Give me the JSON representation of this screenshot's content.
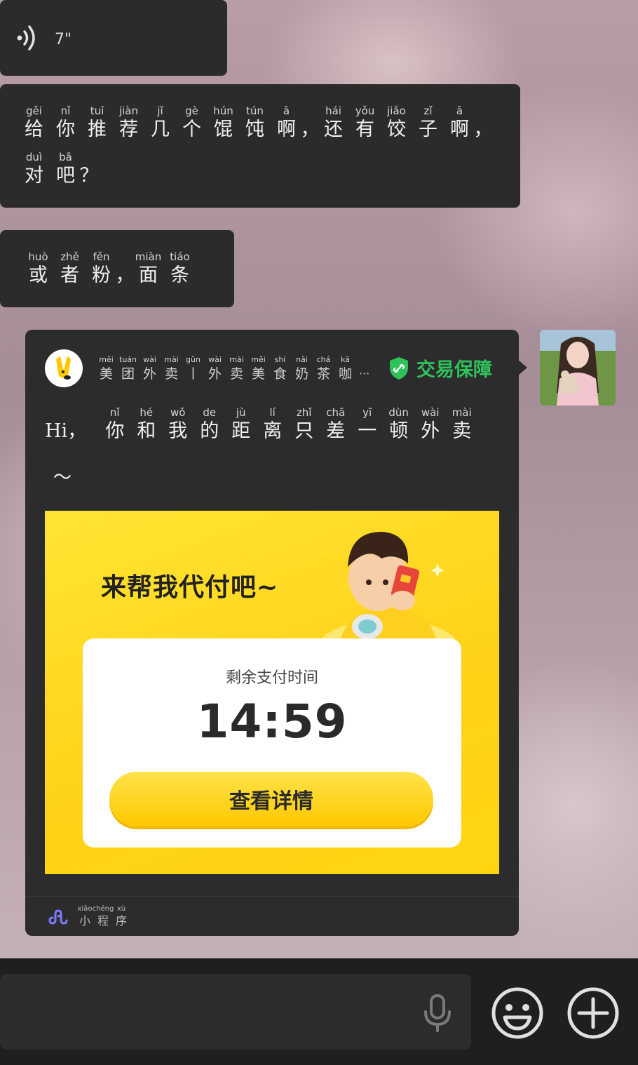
{
  "voice": {
    "duration": "7\""
  },
  "message1": {
    "line1": [
      {
        "py": "gěi",
        "hz": "给"
      },
      {
        "py": "nǐ",
        "hz": "你"
      },
      {
        "py": "tuī",
        "hz": "推"
      },
      {
        "py": "jiàn",
        "hz": "荐"
      },
      {
        "py": "jǐ",
        "hz": "几"
      },
      {
        "py": "gè",
        "hz": "个"
      },
      {
        "py": "hún",
        "hz": "馄"
      },
      {
        "py": "tún",
        "hz": "饨"
      },
      {
        "py": "ā",
        "hz": "啊"
      },
      {
        "py": "",
        "hz": "，"
      },
      {
        "py": "hái",
        "hz": "还"
      },
      {
        "py": "yǒu",
        "hz": "有"
      },
      {
        "py": "jiǎo",
        "hz": "饺"
      },
      {
        "py": "zǐ",
        "hz": "子"
      },
      {
        "py": "ā",
        "hz": "啊"
      },
      {
        "py": "",
        "hz": "，"
      }
    ],
    "line2": [
      {
        "py": "duì",
        "hz": "对"
      },
      {
        "py": "bā",
        "hz": "吧"
      },
      {
        "py": "",
        "hz": "？"
      }
    ]
  },
  "message2": {
    "line1": [
      {
        "py": "huò",
        "hz": "或"
      },
      {
        "py": "zhě",
        "hz": "者"
      },
      {
        "py": "fěn",
        "hz": "粉"
      },
      {
        "py": "",
        "hz": "，"
      },
      {
        "py": "miàn",
        "hz": "面"
      },
      {
        "py": "tiáo",
        "hz": "条"
      }
    ]
  },
  "card": {
    "app_title": [
      {
        "py": "měi",
        "hz": "美"
      },
      {
        "py": "tuán",
        "hz": "团"
      },
      {
        "py": "wài",
        "hz": "外"
      },
      {
        "py": "mài",
        "hz": "卖"
      },
      {
        "py": "gǔn",
        "hz": "丨"
      },
      {
        "py": "wài",
        "hz": "外"
      },
      {
        "py": "mài",
        "hz": "卖"
      },
      {
        "py": "měi",
        "hz": "美"
      },
      {
        "py": "shí",
        "hz": "食"
      },
      {
        "py": "nǎi",
        "hz": "奶"
      },
      {
        "py": "chá",
        "hz": "茶"
      },
      {
        "py": "kā",
        "hz": "咖"
      }
    ],
    "ellipsis": "···",
    "guarantee": "交易保障",
    "greeting_lead": "Hi，",
    "greeting": [
      {
        "py": "nǐ",
        "hz": "你"
      },
      {
        "py": "hé",
        "hz": "和"
      },
      {
        "py": "wǒ",
        "hz": "我"
      },
      {
        "py": "de",
        "hz": "的"
      },
      {
        "py": "jù",
        "hz": "距"
      },
      {
        "py": "lí",
        "hz": "离"
      },
      {
        "py": "zhǐ",
        "hz": "只"
      },
      {
        "py": "chā",
        "hz": "差"
      },
      {
        "py": "yī",
        "hz": "一"
      },
      {
        "py": "dùn",
        "hz": "顿"
      },
      {
        "py": "wài",
        "hz": "外"
      },
      {
        "py": "mài",
        "hz": "卖"
      }
    ],
    "tilde": "～",
    "promo": {
      "title": "来帮我代付吧~",
      "remain_label": "剩余支付时间",
      "countdown": "14:59",
      "button": "查看详情"
    },
    "mini_program": [
      {
        "py": "xiǎo",
        "hz": "小"
      },
      {
        "py": "chéng",
        "hz": "程"
      },
      {
        "py": "xù",
        "hz": "序"
      }
    ]
  },
  "colors": {
    "guarantee_green": "#2fc25b",
    "promo_yellow": "#ffd21a",
    "bubble": "#2b2b2b"
  },
  "icons": [
    "voice-wave-icon",
    "shield-link-icon",
    "mini-program-icon",
    "microphone-icon",
    "emoji-icon",
    "plus-icon"
  ]
}
